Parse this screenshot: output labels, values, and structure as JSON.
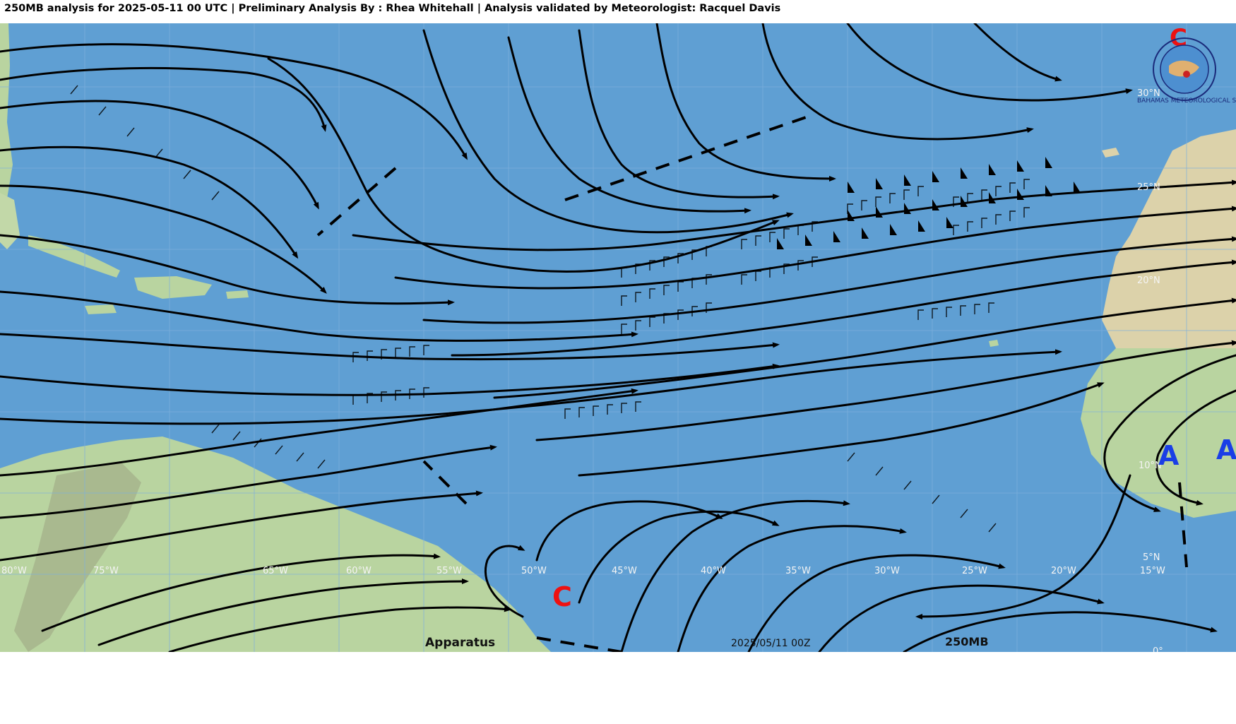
{
  "header": {
    "title": "250MB analysis for 2025-05-11 00 UTC | Preliminary Analysis By : Rhea Whitehall | Analysis validated by Meteorologist: Racquel Davis"
  },
  "map": {
    "colors": {
      "ocean": "#5f9fd3",
      "land_lowland": "#b9d4a0",
      "land_desert": "#dcd2aa",
      "streamline": "#000000",
      "cyclonic_center": "#ee1111",
      "anticyclonic_center": "#1a3ee6"
    },
    "longitude_labels": [
      "80°W",
      "75°W",
      "65°W",
      "60°W",
      "55°W",
      "50°W",
      "45°W",
      "40°W",
      "35°W",
      "30°W",
      "25°W",
      "20°W",
      "15°W"
    ],
    "latitude_labels": [
      "30°N",
      "25°N",
      "20°N",
      "10°N",
      "5°N",
      "0°"
    ],
    "pressure_centers": [
      {
        "letter": "C",
        "kind": "cyclonic"
      },
      {
        "letter": "C",
        "kind": "cyclonic"
      },
      {
        "letter": "A",
        "kind": "anticyclonic"
      },
      {
        "letter": "A",
        "kind": "anticyclonic"
      }
    ],
    "annotations": {
      "valid_time": "2025/05/11 00Z",
      "level": "250MB",
      "watermark": "Apparatus"
    },
    "logo": {
      "text": "BAHAMAS METEOROLOGICAL SERVICES"
    }
  }
}
